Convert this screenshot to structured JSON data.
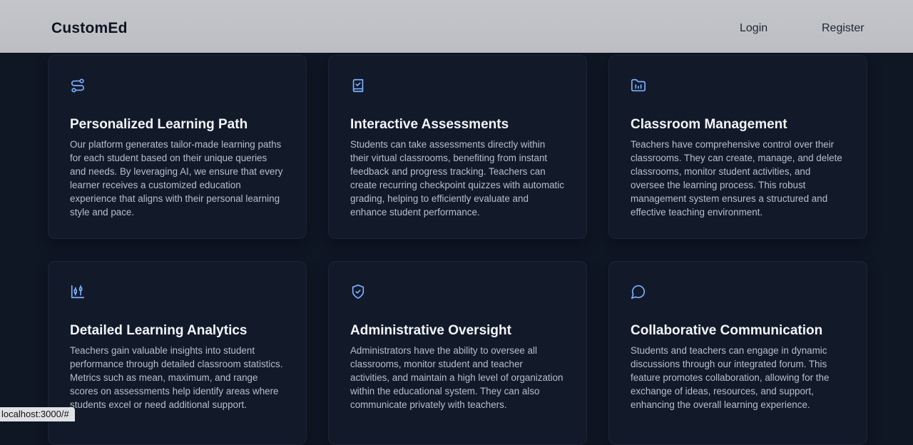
{
  "nav": {
    "brand": "CustomEd",
    "login": "Login",
    "register": "Register"
  },
  "features": [
    {
      "icon": "route-icon",
      "title": "Personalized Learning Path",
      "description": "Our platform generates tailor-made learning paths for each student based on their unique queries and needs. By leveraging AI, we ensure that every learner receives a customized education experience that aligns with their personal learning style and pace."
    },
    {
      "icon": "book-check-icon",
      "title": "Interactive Assessments",
      "description": "Students can take assessments directly within their virtual classrooms, benefiting from instant feedback and progress tracking. Teachers can create recurring checkpoint quizzes with automatic grading, helping to efficiently evaluate and enhance student performance."
    },
    {
      "icon": "folder-chart-icon",
      "title": "Classroom Management",
      "description": "Teachers have comprehensive control over their classrooms. They can create, manage, and delete classrooms, monitor student activities, and oversee the learning process. This robust management system ensures a structured and effective teaching environment."
    },
    {
      "icon": "candlestick-chart-icon",
      "title": "Detailed Learning Analytics",
      "description": "Teachers gain valuable insights into student performance through detailed classroom statistics. Metrics such as mean, maximum, and range scores on assessments help identify areas where students excel or need additional support."
    },
    {
      "icon": "shield-check-icon",
      "title": "Administrative Oversight",
      "description": "Administrators have the ability to oversee all classrooms, monitor student and teacher activities, and maintain a high level of organization within the educational system. They can also communicate privately with teachers."
    },
    {
      "icon": "message-circle-icon",
      "title": "Collaborative Communication",
      "description": "Students and teachers can engage in dynamic discussions through our integrated forum. This feature promotes collaboration, allowing for the exchange of ideas, resources, and support, enhancing the overall learning experience."
    }
  ],
  "status_bar": {
    "url": "localhost:3000/#"
  },
  "colors": {
    "background": "#0f1624",
    "card": "#121a2a",
    "icon_accent": "#7fb0ff",
    "navbar": "#c0c2c6"
  }
}
